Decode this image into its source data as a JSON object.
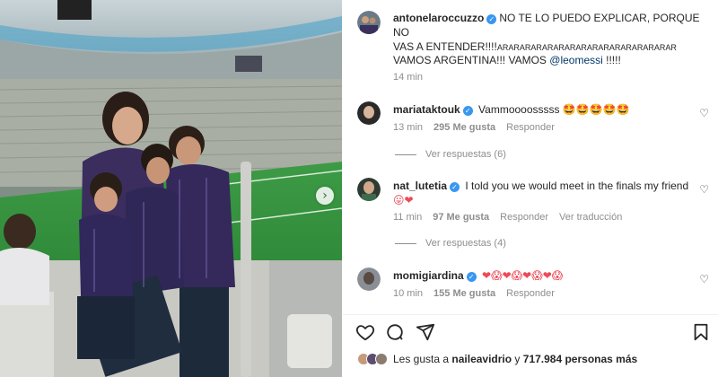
{
  "post": {
    "author": "antonelaroccuzzo",
    "caption_line1": "NO TE LO PUEDO EXPLICAR, PORQUE NO",
    "caption_line2_part1": "VAS A ENTENDER!!!!",
    "caption_line2_part2": "ARARARARARARARARARARARARARARARAR",
    "caption_line3_part1": "VAMOS ARGENTINA!!! VAMOS ",
    "caption_line3_mention": "@leomessi",
    "caption_line3_part2": " !!!!!",
    "time": "14 min"
  },
  "comments": [
    {
      "user": "mariataktouk",
      "text": "Vammoooosssss",
      "emoji": "🤩🤩🤩🤩🤩",
      "time": "13 min",
      "likes": "295 Me gusta",
      "reply": "Responder",
      "translation": "",
      "view_replies": "Ver respuestas (6)"
    },
    {
      "user": "nat_lutetia",
      "text": "I told you we would meet in the finals my friend",
      "emoji": "😛❤",
      "time": "11 min",
      "likes": "97 Me gusta",
      "reply": "Responder",
      "translation": "Ver traducción",
      "view_replies": "Ver respuestas (4)"
    },
    {
      "user": "momigiardina",
      "text": "",
      "emoji": "❤😱❤😱❤😱❤😱",
      "time": "10 min",
      "likes": "155 Me gusta",
      "reply": "Responder",
      "translation": "",
      "view_replies": ""
    }
  ],
  "actions": {
    "like": "heart-outline-icon",
    "comment": "comment-bubble-icon",
    "share": "paper-plane-icon",
    "save": "bookmark-icon"
  },
  "likes_summary": {
    "prefix": "Les gusta a ",
    "user": "naileavidrio",
    "middle": " y ",
    "count": "717.984 personas más"
  },
  "colors": {
    "verified": "#3897f0",
    "meta_gray": "#8e8e8e",
    "mention": "#00376b",
    "heart": "#ed4956"
  }
}
